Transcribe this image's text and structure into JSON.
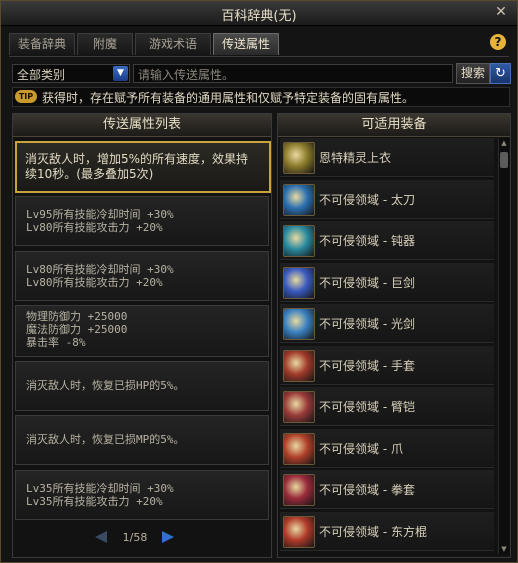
{
  "window": {
    "title": "百科辞典(无)",
    "close_glyph": "✕"
  },
  "tabs": [
    {
      "label": "装备辞典",
      "active": false
    },
    {
      "label": "附魔",
      "active": false
    },
    {
      "label": "游戏术语",
      "active": false
    },
    {
      "label": "传送属性",
      "active": true
    }
  ],
  "help_glyph": "?",
  "filter": {
    "category": "全部类别",
    "search_placeholder": "请输入传送属性。",
    "search_button": "搜索",
    "refresh_glyph": "↻"
  },
  "tip": {
    "badge": "TIP",
    "text": "获得时，存在赋予所有装备的通用属性和仅赋予特定装备的固有属性。"
  },
  "left_panel": {
    "header": "传送属性列表",
    "properties": [
      {
        "lines": [
          "消灭敌人时，增加5%的所有速度，效果持",
          "续10秒。(最多叠加5次)"
        ],
        "selected": true
      },
      {
        "lines": [
          "Lv95所有技能冷却时间 +30%",
          "Lv80所有技能攻击力 +20%"
        ],
        "selected": false
      },
      {
        "lines": [
          "Lv80所有技能冷却时间 +30%",
          "Lv80所有技能攻击力 +20%"
        ],
        "selected": false
      },
      {
        "lines": [
          "物理防御力 +25000",
          "魔法防御力 +25000",
          "暴击率 -8%"
        ],
        "selected": false
      },
      {
        "lines": [
          "消灭敌人时，恢复已损HP的5%。"
        ],
        "selected": false
      },
      {
        "lines": [
          "消灭敌人时，恢复已损MP的5%。"
        ],
        "selected": false
      },
      {
        "lines": [
          "Lv35所有技能冷却时间 +30%",
          "Lv35所有技能攻击力 +20%"
        ],
        "selected": false
      }
    ],
    "pager": {
      "text": "1/58"
    }
  },
  "right_panel": {
    "header": "可适用装备",
    "items": [
      {
        "name": "恩特精灵上衣",
        "icon": "coat-icon",
        "color": "#8a7a2a"
      },
      {
        "name": "不可侵领域 - 太刀",
        "icon": "katana-icon",
        "color": "#2a6fb0"
      },
      {
        "name": "不可侵领域 - 钝器",
        "icon": "mace-icon",
        "color": "#2a8aa0"
      },
      {
        "name": "不可侵领域 - 巨剑",
        "icon": "greatsword-icon",
        "color": "#3a5ac0"
      },
      {
        "name": "不可侵领域 - 光剑",
        "icon": "lightsaber-icon",
        "color": "#3a80c0"
      },
      {
        "name": "不可侵领域 - 手套",
        "icon": "glove-icon",
        "color": "#a03a2a"
      },
      {
        "name": "不可侵领域 - 臂铠",
        "icon": "gauntlet-icon",
        "color": "#9a3a3a"
      },
      {
        "name": "不可侵领域 - 爪",
        "icon": "claw-icon",
        "color": "#b0402a"
      },
      {
        "name": "不可侵领域 - 拳套",
        "icon": "knuckle-icon",
        "color": "#9a2a3a"
      },
      {
        "name": "不可侵领域 - 东方棍",
        "icon": "staff-icon",
        "color": "#b03a2a"
      }
    ]
  }
}
